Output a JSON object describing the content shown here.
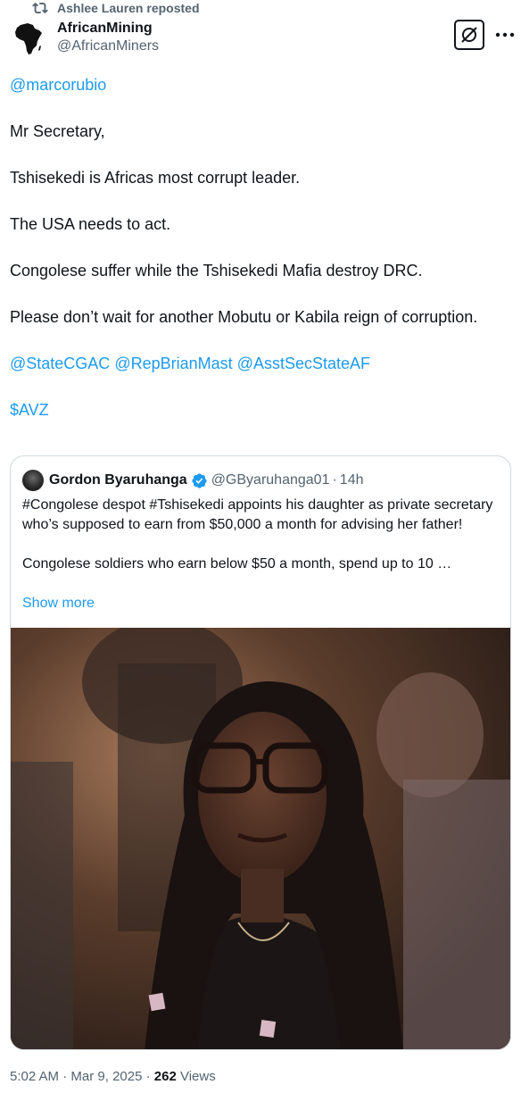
{
  "repost": {
    "label": "Ashlee Lauren reposted"
  },
  "post": {
    "author_name": "AfricanMining",
    "author_handle": "@AfricanMiners",
    "paragraphs": {
      "mention": "@marcorubio",
      "p1": "Mr Secretary,",
      "p2": "Tshisekedi is Africas most corrupt leader.",
      "p3": "The USA needs to act.",
      "p4": "Congolese suffer while the Tshisekedi Mafia destroy DRC.",
      "p5": "Please don’t wait for another Mobutu or Kabila reign of corruption.",
      "mentions": [
        "@StateCGAC",
        "@RepBrianMast",
        "@AsstSecStateAF"
      ],
      "cashtag": "$AVZ"
    }
  },
  "quote": {
    "author_name": "Gordon Byaruhanga",
    "author_handle": "@GByaruhanga01",
    "separator": "·",
    "time": "14h",
    "text_p1": "#Congolese despot #Tshisekedi appoints his daughter as private secretary who’s supposed to earn from $50,000 a month for advising her father!",
    "text_p2": "Congolese soldiers who earn below $50 a month, spend up to 10 …",
    "show_more": "Show more"
  },
  "footer": {
    "time": "5:02 AM",
    "separator": "·",
    "date": "Mar 9, 2025",
    "views_count": "262",
    "views_label": "Views"
  },
  "icons": {
    "repost": "repost-icon",
    "grok": "grok-icon",
    "more": "more-icon",
    "verified": "verified-badge-icon"
  },
  "colors": {
    "link": "#1d9bf0",
    "secondary_text": "#536471",
    "primary_text": "#0f1419",
    "border": "#cfd9de"
  }
}
